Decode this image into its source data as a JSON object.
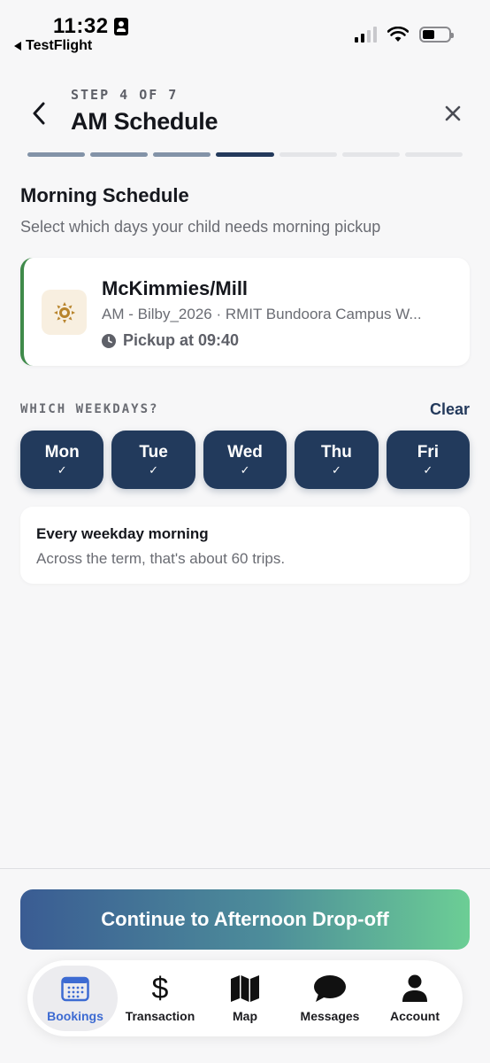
{
  "status_bar": {
    "time": "11:32",
    "back_app": "TestFlight"
  },
  "header": {
    "step": "STEP 4 OF 7",
    "title": "AM Schedule",
    "progress": {
      "total": 7,
      "current": 4
    }
  },
  "section": {
    "title": "Morning Schedule",
    "subtitle": "Select which days your child needs morning pickup"
  },
  "route_card": {
    "name": "McKimmies/Mill",
    "description": "AM - Bilby_2026 · RMIT Bundoora Campus W...",
    "pickup": "Pickup at 09:40",
    "accent_color": "#3f8a4a",
    "icon": "sun-icon"
  },
  "weekdays": {
    "label": "WHICH WEEKDAYS?",
    "clear_label": "Clear",
    "days": [
      {
        "label": "Mon",
        "selected": true
      },
      {
        "label": "Tue",
        "selected": true
      },
      {
        "label": "Wed",
        "selected": true
      },
      {
        "label": "Thu",
        "selected": true
      },
      {
        "label": "Fri",
        "selected": true
      }
    ],
    "selected_color": "#223a5c"
  },
  "summary": {
    "title": "Every weekday morning",
    "subtitle": "Across the term, that's about 60 trips."
  },
  "continue_button": {
    "label": "Continue to Afternoon Drop-off"
  },
  "tab_bar": {
    "active": "Bookings",
    "tabs": [
      {
        "label": "Bookings",
        "icon": "calendar-icon"
      },
      {
        "label": "Transaction",
        "icon": "dollar-icon"
      },
      {
        "label": "Map",
        "icon": "map-icon"
      },
      {
        "label": "Messages",
        "icon": "chat-bubble-icon"
      },
      {
        "label": "Account",
        "icon": "person-icon"
      }
    ],
    "active_color": "#3d6bd2"
  }
}
